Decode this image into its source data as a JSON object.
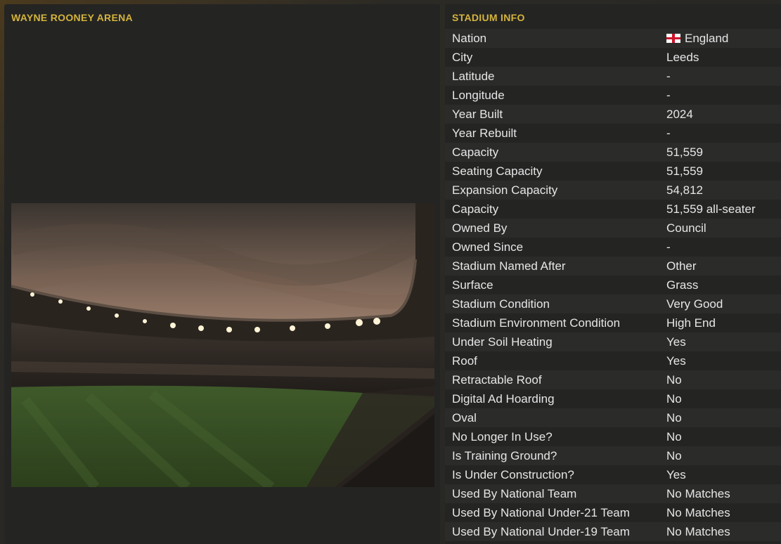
{
  "stadium_panel": {
    "title": "WAYNE ROONEY ARENA"
  },
  "info_panel": {
    "title": "STADIUM INFO",
    "rows": [
      {
        "label": "Nation",
        "value": "England",
        "icon": "england-flag-icon"
      },
      {
        "label": "City",
        "value": "Leeds"
      },
      {
        "label": "Latitude",
        "value": "-"
      },
      {
        "label": "Longitude",
        "value": "-"
      },
      {
        "label": "Year Built",
        "value": "2024"
      },
      {
        "label": "Year Rebuilt",
        "value": "-"
      },
      {
        "label": "Capacity",
        "value": "51,559"
      },
      {
        "label": "Seating Capacity",
        "value": "51,559"
      },
      {
        "label": "Expansion Capacity",
        "value": "54,812"
      },
      {
        "label": "Capacity",
        "value": "51,559 all-seater"
      },
      {
        "label": "Owned By",
        "value": "Council"
      },
      {
        "label": "Owned Since",
        "value": "-"
      },
      {
        "label": "Stadium Named After",
        "value": "Other"
      },
      {
        "label": "Surface",
        "value": "Grass"
      },
      {
        "label": "Stadium Condition",
        "value": "Very Good"
      },
      {
        "label": "Stadium Environment Condition",
        "value": "High End"
      },
      {
        "label": "Under Soil Heating",
        "value": "Yes"
      },
      {
        "label": "Roof",
        "value": "Yes"
      },
      {
        "label": "Retractable Roof",
        "value": "No"
      },
      {
        "label": "Digital Ad Hoarding",
        "value": "No"
      },
      {
        "label": "Oval",
        "value": "No"
      },
      {
        "label": "No Longer In Use?",
        "value": "No"
      },
      {
        "label": "Is Training Ground?",
        "value": "No"
      },
      {
        "label": "Is Under Construction?",
        "value": "Yes"
      },
      {
        "label": "Used By National Team",
        "value": "No Matches"
      },
      {
        "label": "Used By National Under-21 Team",
        "value": "No Matches"
      },
      {
        "label": "Used By National Under-19 Team",
        "value": "No Matches"
      }
    ]
  },
  "colors": {
    "accent": "#d4b43c",
    "text": "#e6e6e6",
    "panel": "#242423",
    "row_alt": "#2b2b2a"
  }
}
